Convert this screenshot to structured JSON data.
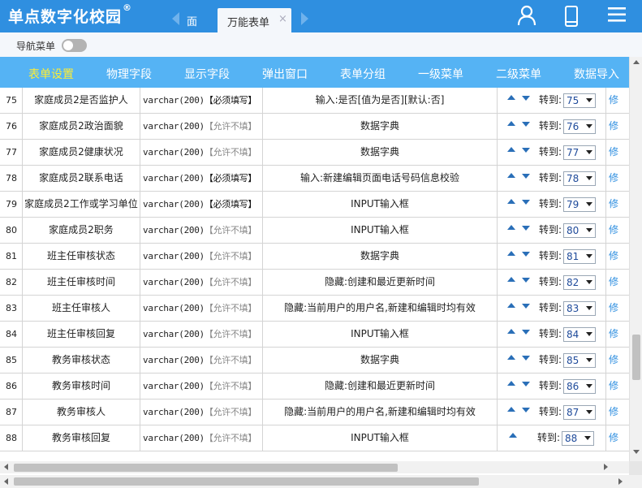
{
  "app": {
    "logo_text": "单点数字化校园",
    "logo_mark": "®"
  },
  "header": {
    "tab_inactive": "面",
    "tab_active": "万能表单",
    "tab_close": "×"
  },
  "toggle_bar": {
    "label": "导航菜单",
    "on": false
  },
  "menu": {
    "items": [
      {
        "label": "表单设置",
        "active": true
      },
      {
        "label": "物理字段",
        "active": false
      },
      {
        "label": "显示字段",
        "active": false
      },
      {
        "label": "弹出窗口",
        "active": false
      },
      {
        "label": "表单分组",
        "active": false
      },
      {
        "label": "一级菜单",
        "active": false
      },
      {
        "label": "二级菜单",
        "active": false
      },
      {
        "label": "数据导入",
        "active": false
      }
    ]
  },
  "table": {
    "goto_label": "转到:",
    "edit_label": "修",
    "rows": [
      {
        "num": "75",
        "name": "家庭成员2是否监护人",
        "type": "varchar(200)",
        "flag": "【必须填写】",
        "required": true,
        "desc": "输入:是否[值为是否][默认:否]",
        "goto": "75",
        "show_down": true
      },
      {
        "num": "76",
        "name": "家庭成员2政治面貌",
        "type": "varchar(200)",
        "flag": "【允许不填】",
        "required": false,
        "desc": "数据字典",
        "goto": "76",
        "show_down": true
      },
      {
        "num": "77",
        "name": "家庭成员2健康状况",
        "type": "varchar(200)",
        "flag": "【允许不填】",
        "required": false,
        "desc": "数据字典",
        "goto": "77",
        "show_down": true
      },
      {
        "num": "78",
        "name": "家庭成员2联系电话",
        "type": "varchar(200)",
        "flag": "【必须填写】",
        "required": true,
        "desc": "输入:新建编辑页面电话号码信息校验",
        "goto": "78",
        "show_down": true
      },
      {
        "num": "79",
        "name": "家庭成员2工作或学习单位",
        "type": "varchar(200)",
        "flag": "【必须填写】",
        "required": true,
        "desc": "INPUT输入框",
        "goto": "79",
        "show_down": true
      },
      {
        "num": "80",
        "name": "家庭成员2职务",
        "type": "varchar(200)",
        "flag": "【允许不填】",
        "required": false,
        "desc": "INPUT输入框",
        "goto": "80",
        "show_down": true
      },
      {
        "num": "81",
        "name": "班主任审核状态",
        "type": "varchar(200)",
        "flag": "【允许不填】",
        "required": false,
        "desc": "数据字典",
        "goto": "81",
        "show_down": true
      },
      {
        "num": "82",
        "name": "班主任审核时间",
        "type": "varchar(200)",
        "flag": "【允许不填】",
        "required": false,
        "desc": "隐藏:创建和最近更新时间",
        "goto": "82",
        "show_down": true
      },
      {
        "num": "83",
        "name": "班主任审核人",
        "type": "varchar(200)",
        "flag": "【允许不填】",
        "required": false,
        "desc": "隐藏:当前用户的用户名,新建和编辑时均有效",
        "goto": "83",
        "show_down": true
      },
      {
        "num": "84",
        "name": "班主任审核回复",
        "type": "varchar(200)",
        "flag": "【允许不填】",
        "required": false,
        "desc": "INPUT输入框",
        "goto": "84",
        "show_down": true
      },
      {
        "num": "85",
        "name": "教务审核状态",
        "type": "varchar(200)",
        "flag": "【允许不填】",
        "required": false,
        "desc": "数据字典",
        "goto": "85",
        "show_down": true
      },
      {
        "num": "86",
        "name": "教务审核时间",
        "type": "varchar(200)",
        "flag": "【允许不填】",
        "required": false,
        "desc": "隐藏:创建和最近更新时间",
        "goto": "86",
        "show_down": true
      },
      {
        "num": "87",
        "name": "教务审核人",
        "type": "varchar(200)",
        "flag": "【允许不填】",
        "required": false,
        "desc": "隐藏:当前用户的用户名,新建和编辑时均有效",
        "goto": "87",
        "show_down": true
      },
      {
        "num": "88",
        "name": "教务审核回复",
        "type": "varchar(200)",
        "flag": "【允许不填】",
        "required": false,
        "desc": "INPUT输入框",
        "goto": "88",
        "show_down": false
      }
    ]
  }
}
